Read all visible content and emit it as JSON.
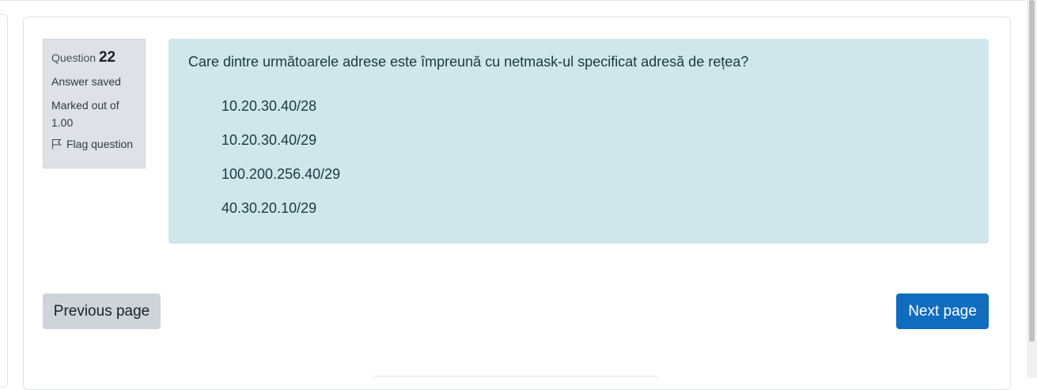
{
  "question_info": {
    "label": "Question",
    "number": "22",
    "status": "Answer saved",
    "marked_out_of": "Marked out of 1.00",
    "flag_label": "Flag question"
  },
  "question": {
    "text": "Care dintre următoarele adrese este împreună cu netmask-ul specificat adresă de rețea?",
    "answers": [
      "10.20.30.40/28",
      "10.20.30.40/29",
      "100.200.256.40/29",
      "40.30.20.10/29"
    ]
  },
  "navigation": {
    "previous_label": "Previous page",
    "next_label": "Next page"
  },
  "colors": {
    "content_bg": "#cfe7ea",
    "info_bg": "#dee2e6",
    "primary": "#0f6cbf",
    "secondary": "#ced4da"
  }
}
